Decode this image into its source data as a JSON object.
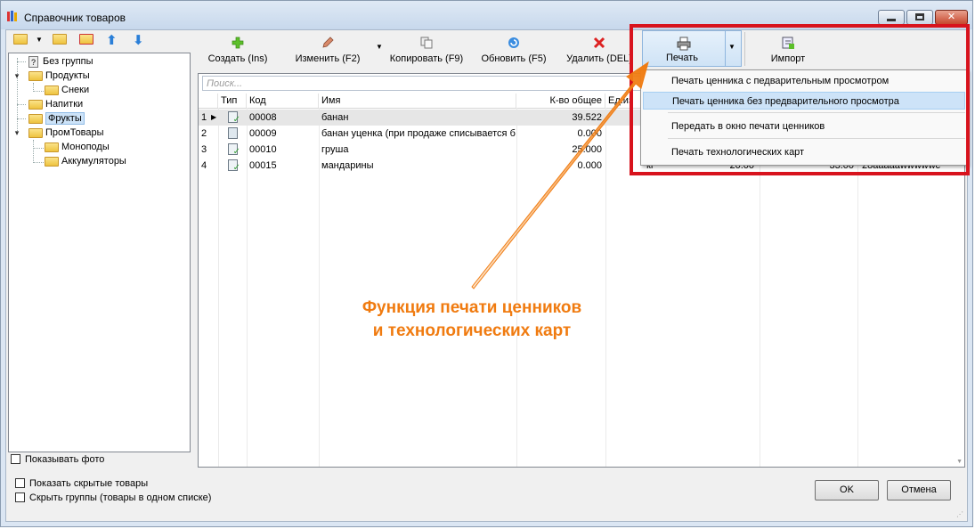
{
  "window": {
    "title": "Справочник товаров"
  },
  "tree": {
    "items": [
      {
        "label": "Без группы",
        "icon": "question-doc-icon"
      },
      {
        "label": "Продукты",
        "icon": "folder-icon"
      },
      {
        "label": "Снеки",
        "icon": "folder-icon"
      },
      {
        "label": "Напитки",
        "icon": "folder-icon"
      },
      {
        "label": "Фрукты",
        "icon": "folder-icon",
        "selected": true
      },
      {
        "label": "ПромТовары",
        "icon": "folder-icon"
      },
      {
        "label": "Моноподы",
        "icon": "folder-icon"
      },
      {
        "label": "Аккумуляторы",
        "icon": "folder-icon"
      }
    ],
    "show_photo": "Показывать фото"
  },
  "toolbar": {
    "create": "Создать (Ins)",
    "edit": "Изменить (F2)",
    "copy": "Копировать (F9)",
    "refresh": "Обновить (F5)",
    "delete": "Удалить (DEL)",
    "print": "Печать",
    "import": "Импорт"
  },
  "search": {
    "placeholder": "Поиск..."
  },
  "table": {
    "columns": [
      "Тип",
      "Код",
      "Имя",
      "К-во общее",
      "Ед.из"
    ],
    "rows": [
      {
        "num": "1",
        "code": "00008",
        "name": "банан",
        "qty": "39.522"
      },
      {
        "num": "2",
        "code": "00009",
        "name": "банан уценка (при продаже списывается б",
        "qty": "0.000"
      },
      {
        "num": "3",
        "code": "00010",
        "name": "груша",
        "qty": "25.000"
      },
      {
        "num": "4",
        "code": "00015",
        "name": "мандарины",
        "qty": "0.000",
        "unit": "кг",
        "price1": "20.00",
        "price2": "33.00",
        "extra": "28aaaaawwwwwc"
      }
    ]
  },
  "print_menu": {
    "items": [
      "Печать ценника с педварительным просмотром",
      "Печать ценника без предварительного просмотра",
      "Передать в окно печати ценников",
      "Печать технологических карт"
    ]
  },
  "bottom": {
    "show_hidden": "Показать скрытые товары",
    "hide_groups": "Скрыть группы (товары в одном списке)",
    "ok": "OK",
    "cancel": "Отмена"
  },
  "annotation": {
    "line1": "Функция печати ценников",
    "line2": "и технологических карт"
  },
  "colors": {
    "annotation": "#f07b10",
    "highlight_box": "#d8131d",
    "selection": "#cde3f8"
  }
}
